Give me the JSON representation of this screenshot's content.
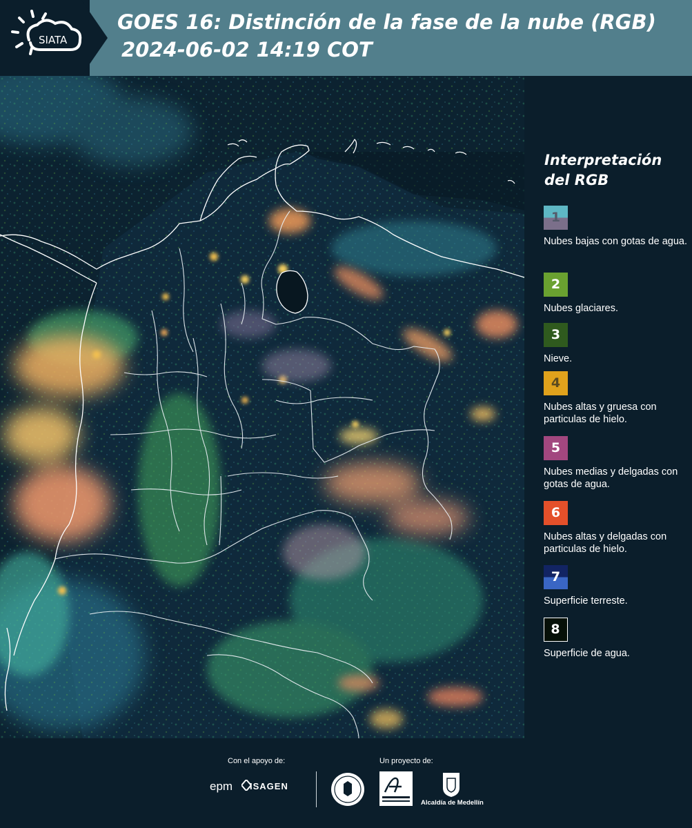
{
  "header": {
    "logo_text": "SIATA",
    "title": "GOES 16: Distinción de la fase de la nube (RGB)",
    "datetime": "2024-06-02 14:19 COT"
  },
  "legend": {
    "title": "Interpretación del RGB",
    "items": [
      {
        "number": "1",
        "label": "Nubes bajas con gotas de agua.",
        "color_top": "#5eb7c4",
        "color_bottom": "#7b6f8a"
      },
      {
        "number": "2",
        "label": "Nubes glaciares.",
        "color_top": "#6aa130",
        "color_bottom": "#6aa130"
      },
      {
        "number": "3",
        "label": "Nieve.",
        "color_top": "#2f5a1e",
        "color_bottom": "#2f5a1e"
      },
      {
        "number": "4",
        "label": "Nubes altas y gruesa con particulas de hielo.",
        "color_top": "#e0a21c",
        "color_bottom": "#e0a21c"
      },
      {
        "number": "5",
        "label": "Nubes medias y delgadas con gotas de agua.",
        "color_top": "#a2477f",
        "color_bottom": "#a2477f"
      },
      {
        "number": "6",
        "label": "Nubes altas y delgadas con particulas de hielo.",
        "color_top": "#e4502a",
        "color_bottom": "#e4502a"
      },
      {
        "number": "7",
        "label": "Superficie terreste.",
        "color_top": "#122463",
        "color_bottom": "#3a66c4"
      },
      {
        "number": "8",
        "label": "Superficie de agua.",
        "color_top": "#061008",
        "color_bottom": "#061008"
      }
    ]
  },
  "footer": {
    "support_label": "Con el apoyo de:",
    "project_label": "Un proyecto de:",
    "sponsor_1": "epm",
    "sponsor_2": "ISAGEN",
    "partner_3": "Alcaldía de Medellín"
  },
  "colors": {
    "header_bg": "#527f8c",
    "panel_bg": "#0b1e2b",
    "cloud_warm": "#f4a45c",
    "cloud_green": "#7fc94a",
    "cloud_cyan": "#5fc7c4"
  }
}
